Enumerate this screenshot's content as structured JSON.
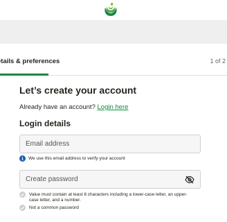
{
  "logo": {
    "icon": "woolworths-logo"
  },
  "progress": {
    "step_label": "etails & preferences",
    "step_count": "1 of 2",
    "accent": "#178841"
  },
  "main": {
    "title": "Let’s create your account",
    "signin_prompt": "Already have an account? ",
    "login_link": "Login here",
    "section_title": "Login details"
  },
  "email": {
    "placeholder": "Email address",
    "helper_text": "We use this email address to verify your account",
    "info_icon": "info-icon"
  },
  "password": {
    "placeholder": "Create password",
    "visibility_icon": "eye-slash-icon",
    "rules": [
      "Value must contain at least 8 characters including a lower-case letter, an upper-case letter, and a number.",
      "Not a common password"
    ]
  },
  "colors": {
    "brand_green": "#178841",
    "info_blue": "#1a5dad",
    "field_bg": "#f6f6f6"
  }
}
